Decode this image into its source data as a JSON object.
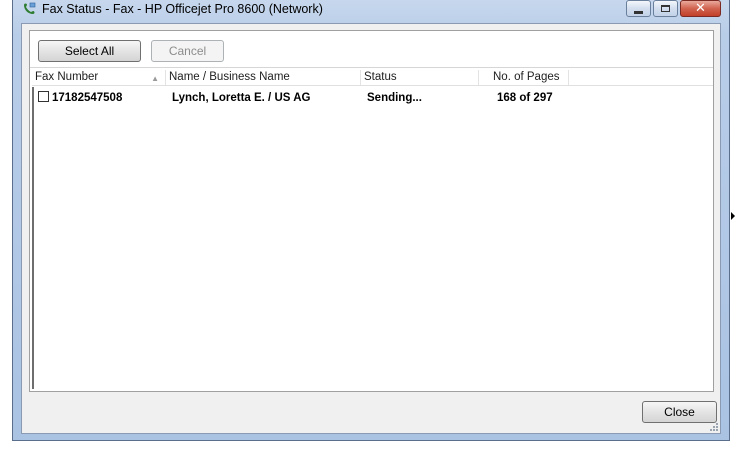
{
  "window": {
    "title": "Fax Status - Fax - HP Officejet Pro 8600 (Network)",
    "app_icon": "fax-phone-icon",
    "caption_buttons": [
      "minimize",
      "maximize",
      "close"
    ],
    "close_glyph": "✕"
  },
  "toolbar": {
    "select_all_label": "Select All",
    "cancel_label": "Cancel"
  },
  "list": {
    "columns": [
      "Fax Number",
      "Name / Business Name",
      "Status",
      "No. of Pages"
    ],
    "sort_indicator": "▲",
    "rows": [
      {
        "checked": false,
        "fax_number": "17182547508",
        "name": "Lynch, Loretta E. / US AG",
        "status": "Sending...",
        "pages": "168 of 297"
      }
    ]
  },
  "footer": {
    "close_label": "Close"
  },
  "colors": {
    "frame": "#aac3e3",
    "close_button": "#c2402a",
    "client_bg": "#f0f0f0"
  }
}
